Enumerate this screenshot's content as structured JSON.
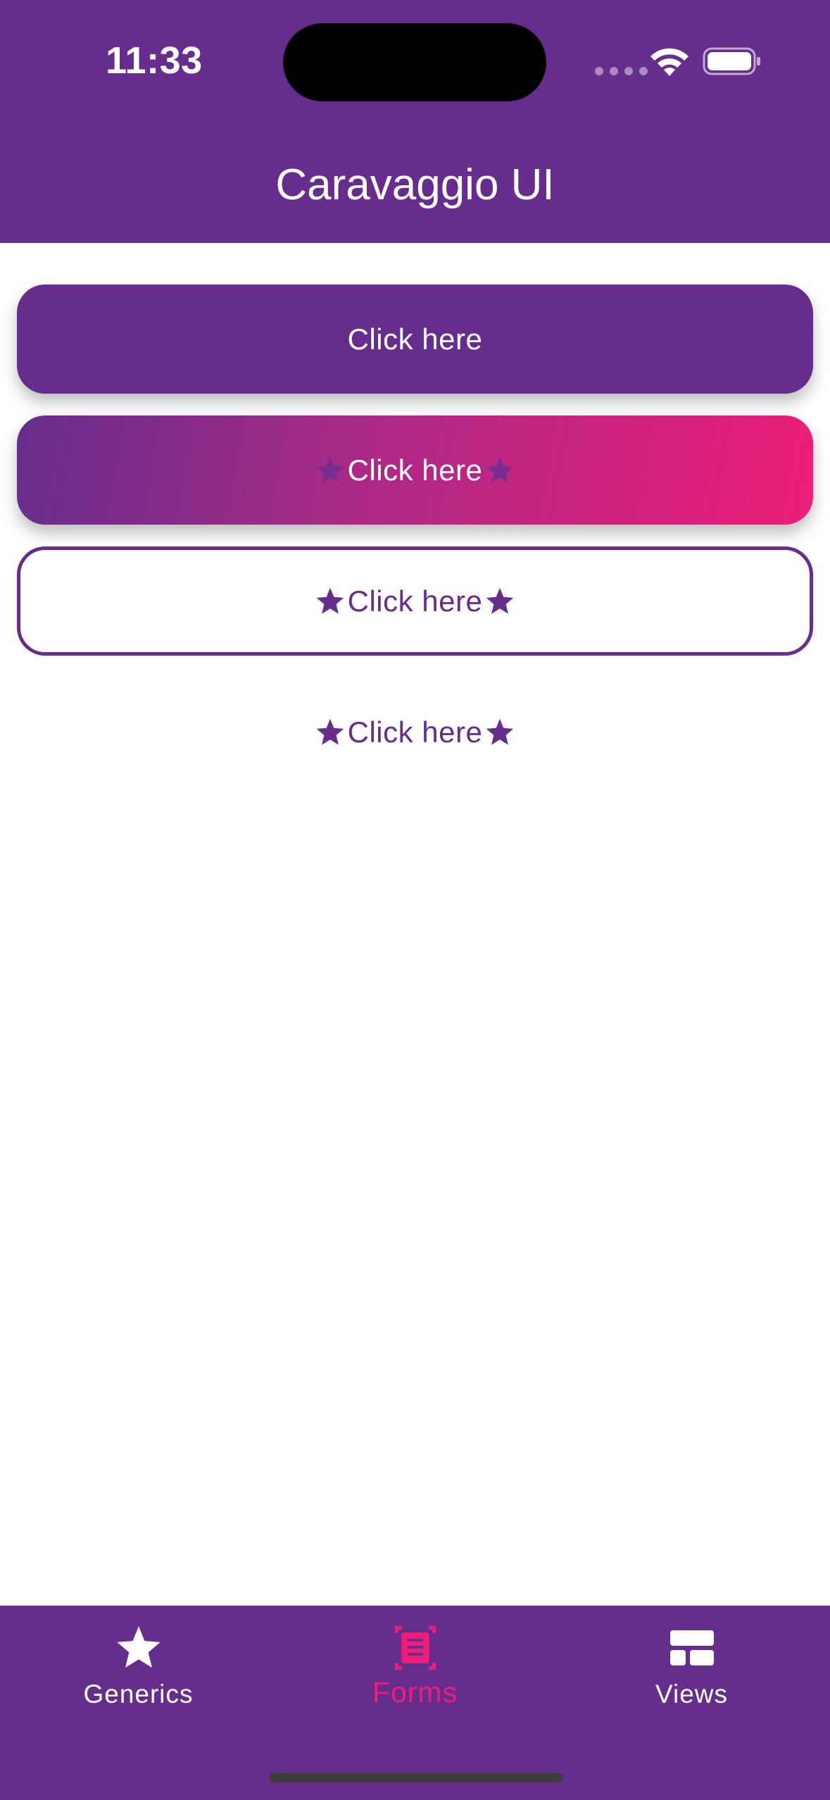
{
  "status_bar": {
    "time": "11:33"
  },
  "app_bar": {
    "title": "Caravaggio UI"
  },
  "buttons": [
    {
      "label": "Click here",
      "style": "solid",
      "icons": "none"
    },
    {
      "label": "Click here",
      "style": "gradient",
      "icons": "star-both-sides"
    },
    {
      "label": "Click here",
      "style": "outline",
      "icons": "star-both-sides"
    },
    {
      "label": "Click here",
      "style": "text",
      "icons": "star-both-sides"
    }
  ],
  "bottom_nav": {
    "items": [
      {
        "label": "Generics",
        "icon": "star-icon",
        "active": false
      },
      {
        "label": "Forms",
        "icon": "form-icon",
        "active": true
      },
      {
        "label": "Views",
        "icon": "layout-icon",
        "active": false
      }
    ]
  },
  "colors": {
    "primary": "#662d8c",
    "accent": "#ed1e79",
    "background": "#ffffff",
    "on_primary": "#ffffff"
  }
}
